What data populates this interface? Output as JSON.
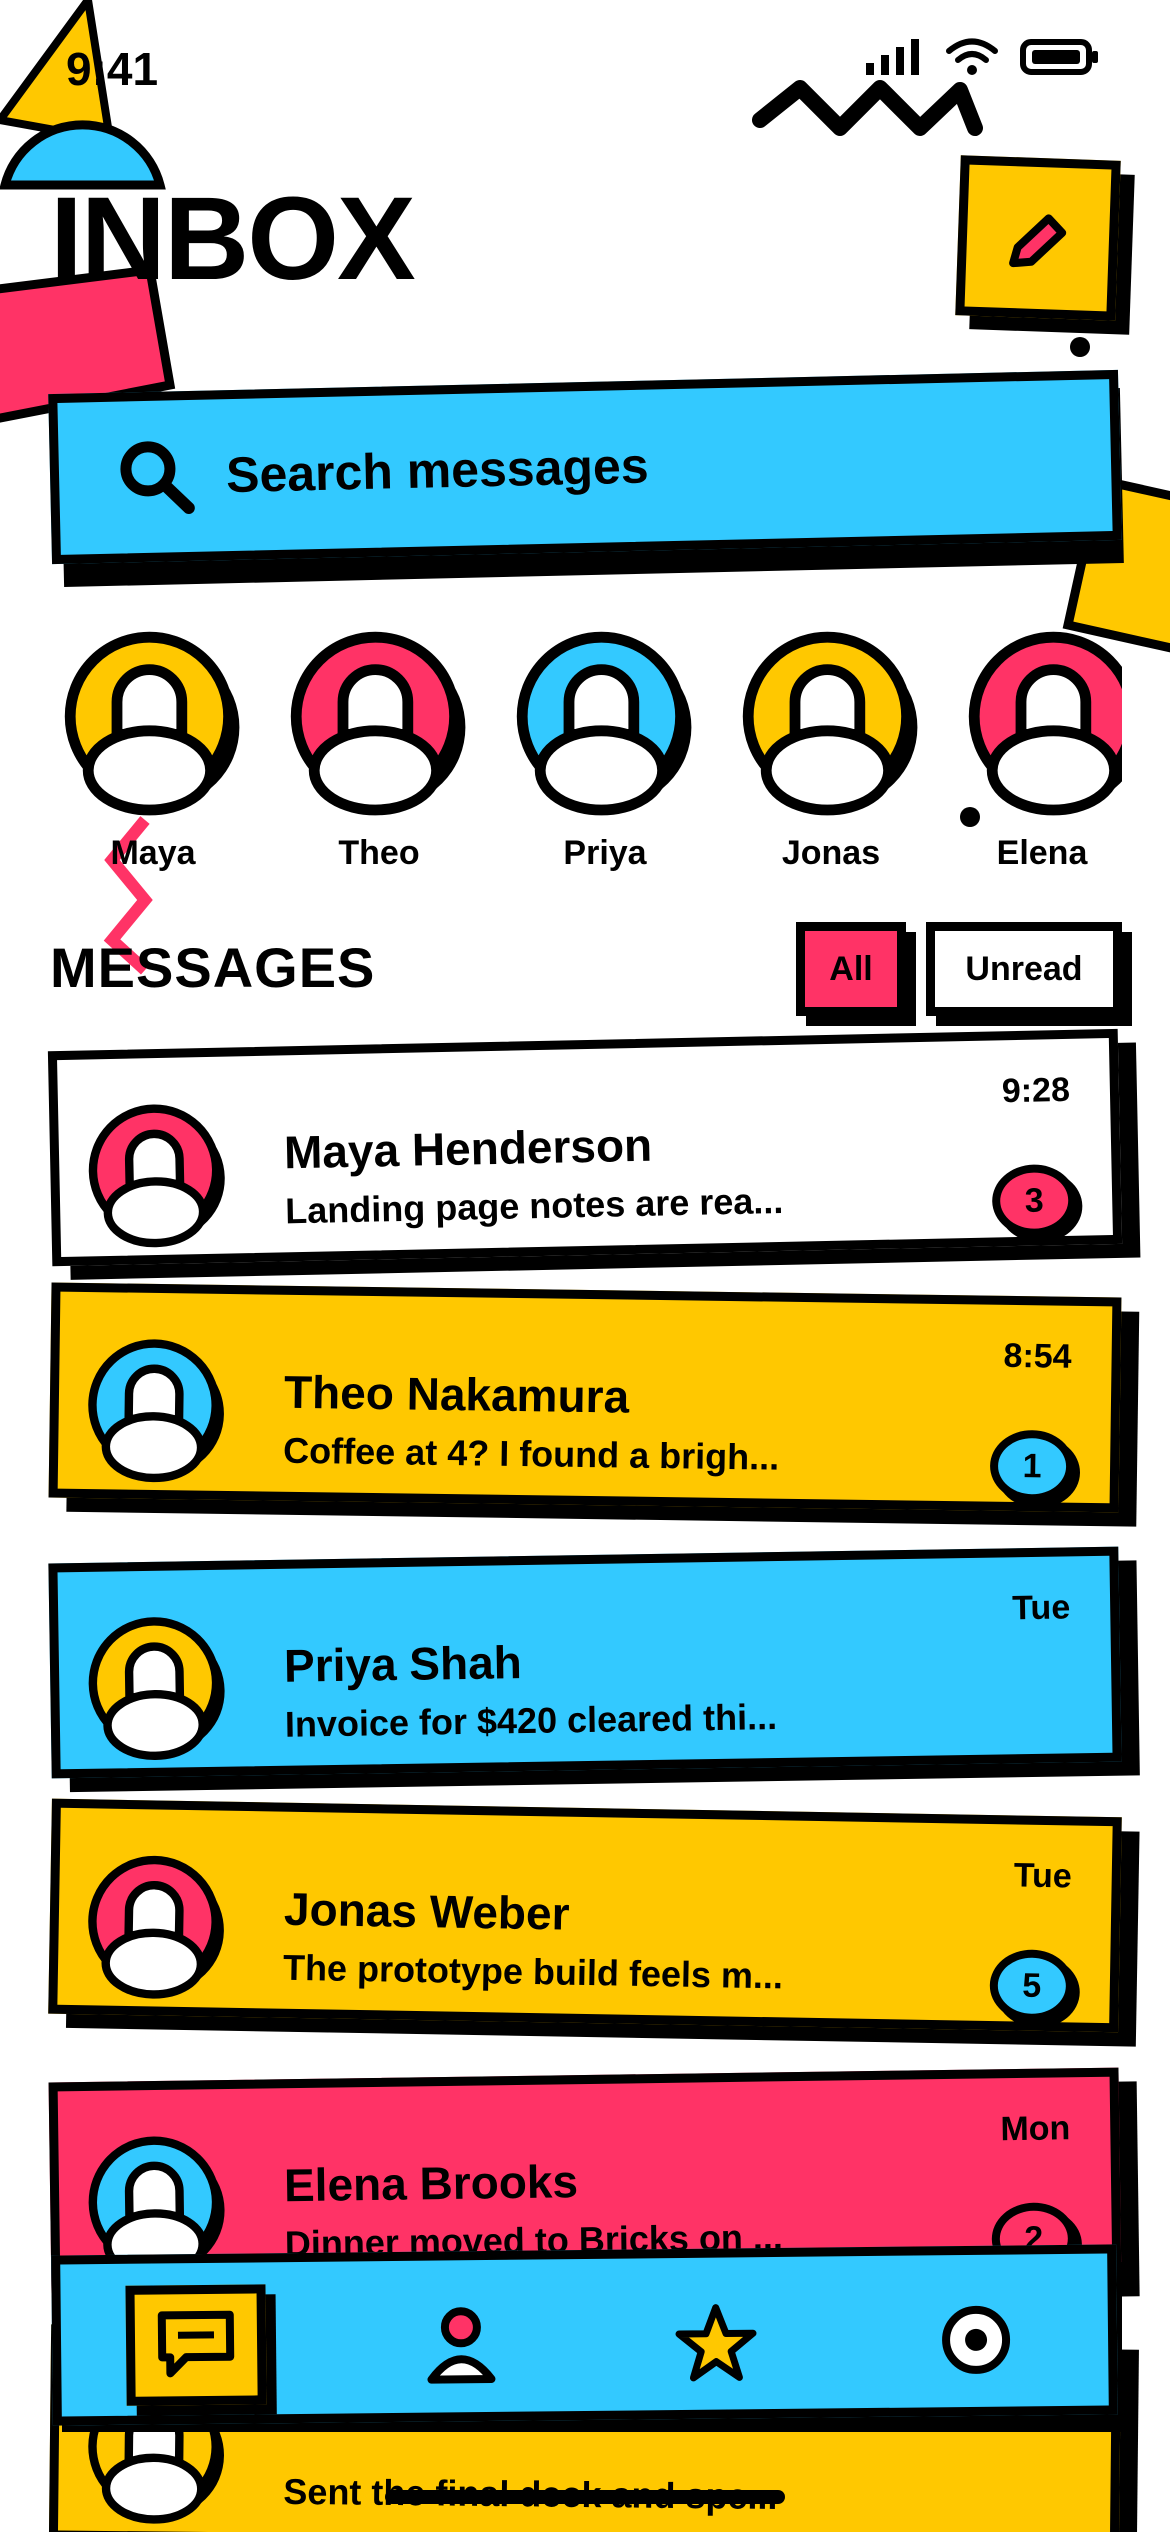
{
  "status_bar": {
    "time": "9:41"
  },
  "header": {
    "title": "INBOX"
  },
  "search": {
    "placeholder": "Search messages"
  },
  "stories": [
    {
      "name": "Maya",
      "color": "#FFC800"
    },
    {
      "name": "Theo",
      "color": "#FF3366"
    },
    {
      "name": "Priya",
      "color": "#33C9FF"
    },
    {
      "name": "Jonas",
      "color": "#FFC800"
    },
    {
      "name": "Elena",
      "color": "#FF3366"
    }
  ],
  "messages_section": {
    "heading": "MESSAGES",
    "filters": {
      "all": "All",
      "unread": "Unread",
      "active": "All"
    }
  },
  "messages": [
    {
      "name": "Maya Henderson",
      "preview": "Landing page notes are rea...",
      "time": "9:28",
      "unread": "3",
      "card_color": "#FFFFFF",
      "avatar_color": "#FF3366",
      "badge_color": "#FF3366"
    },
    {
      "name": "Theo Nakamura",
      "preview": "Coffee at 4? I found a brigh...",
      "time": "8:54",
      "unread": "1",
      "card_color": "#FFC800",
      "avatar_color": "#33C9FF",
      "badge_color": "#33C9FF"
    },
    {
      "name": "Priya Shah",
      "preview": "Invoice for $420 cleared thi...",
      "time": "Tue",
      "unread": "",
      "card_color": "#33C9FF",
      "avatar_color": "#FFC800",
      "badge_color": ""
    },
    {
      "name": "Jonas Weber",
      "preview": "The prototype build feels m...",
      "time": "Tue",
      "unread": "5",
      "card_color": "#FFC800",
      "avatar_color": "#FF3366",
      "badge_color": "#33C9FF"
    },
    {
      "name": "Elena Brooks",
      "preview": "Dinner moved to Bricks on ...",
      "time": "Mon",
      "unread": "2",
      "card_color": "#FF3366",
      "avatar_color": "#33C9FF",
      "badge_color": "#FF3366"
    },
    {
      "name": "",
      "preview": "Sent the final deck and spe...",
      "time": "",
      "unread": "",
      "card_color": "#FFC800",
      "avatar_color": "#FFC800",
      "badge_color": ""
    }
  ],
  "tab_bar": {
    "tabs": [
      {
        "icon": "chat-bubble-icon",
        "active": true
      },
      {
        "icon": "profile-icon",
        "active": false
      },
      {
        "icon": "star-icon",
        "active": false
      },
      {
        "icon": "settings-ring-icon",
        "active": false
      }
    ]
  },
  "colors": {
    "yellow": "#FFC800",
    "pink": "#FF3366",
    "blue": "#33C9FF",
    "black": "#000000"
  }
}
